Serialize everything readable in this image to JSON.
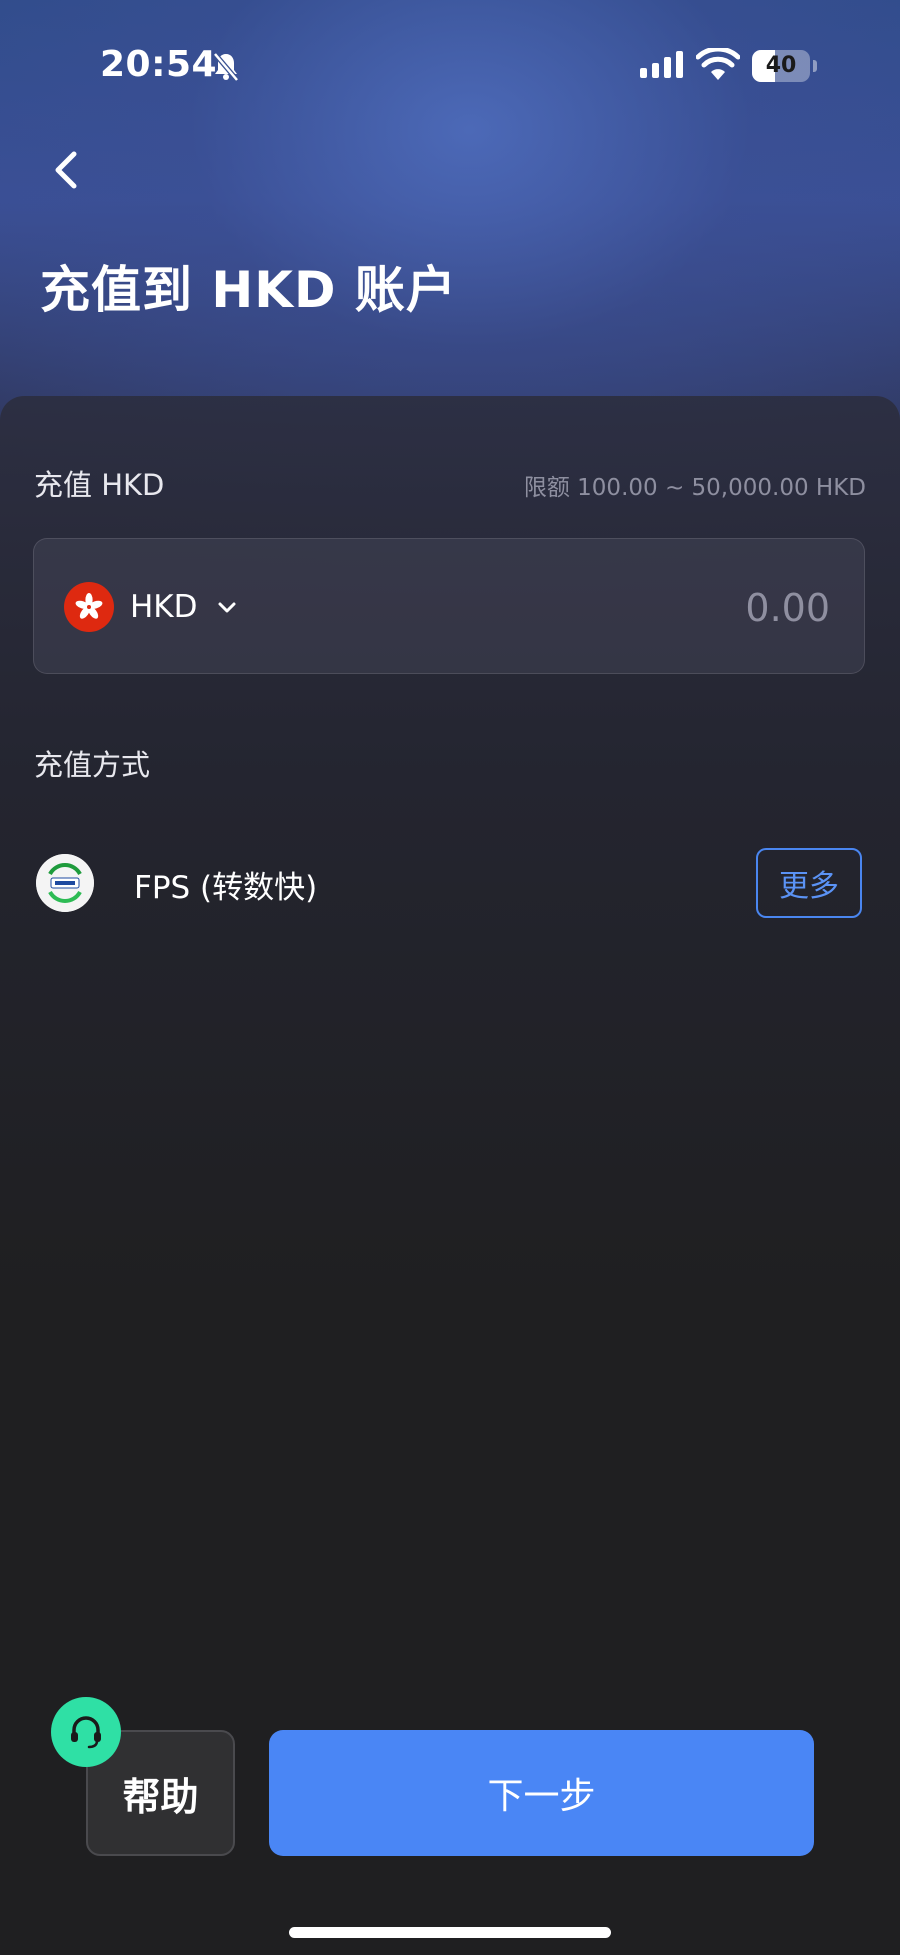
{
  "status_bar": {
    "time": "20:54",
    "battery": "40",
    "battery_level_percent": 40
  },
  "header": {
    "title": "充值到 HKD 账户"
  },
  "amount_section": {
    "label": "充值 HKD",
    "limit": "限额 100.00 ~ 50,000.00 HKD",
    "currency_code": "HKD",
    "amount_placeholder": "0.00"
  },
  "method_section": {
    "label": "充值方式",
    "method_name": "FPS (转数快)",
    "more_label": "更多"
  },
  "footer": {
    "help_label": "帮助",
    "next_label": "下一步"
  },
  "icons": {
    "back": "back-arrow-icon",
    "bell_off": "bell-off-icon",
    "signal": "signal-icon",
    "wifi": "wifi-icon",
    "battery": "battery-icon",
    "flag": "hk-flag-icon",
    "chevron": "chevron-down-icon",
    "fps": "fps-logo-icon",
    "headset": "headset-icon"
  },
  "colors": {
    "accent": "#4a86f5",
    "help_badge": "#2fe0a5",
    "flag_red": "#de2910"
  }
}
